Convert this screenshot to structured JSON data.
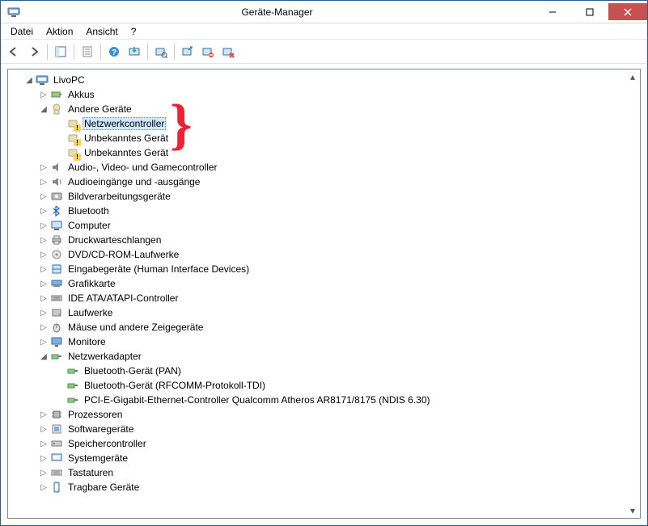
{
  "window": {
    "title": "Geräte-Manager"
  },
  "menu": {
    "file": "Datei",
    "action": "Aktion",
    "view": "Ansicht",
    "help": "?"
  },
  "root": "LivoPC",
  "nodes": {
    "akkus": "Akkus",
    "andere": "Andere Geräte",
    "andere_children": [
      "Netzwerkcontroller",
      "Unbekanntes Gerät",
      "Unbekanntes Gerät"
    ],
    "audio": "Audio-, Video- und Gamecontroller",
    "audioio": "Audioeingänge und -ausgänge",
    "bild": "Bildverarbeitungsgeräte",
    "bt": "Bluetooth",
    "computer": "Computer",
    "druck": "Druckwarteschlangen",
    "dvd": "DVD/CD-ROM-Laufwerke",
    "hid": "Eingabegeräte (Human Interface Devices)",
    "grafik": "Grafikkarte",
    "ide": "IDE ATA/ATAPI-Controller",
    "lauf": "Laufwerke",
    "maus": "Mäuse und andere Zeigegeräte",
    "mon": "Monitore",
    "net": "Netzwerkadapter",
    "net_children": [
      "Bluetooth-Gerät (PAN)",
      "Bluetooth-Gerät (RFCOMM-Protokoll-TDI)",
      "PCI-E-Gigabit-Ethernet-Controller Qualcomm Atheros AR8171/8175 (NDIS 6.30)"
    ],
    "proz": "Prozessoren",
    "soft": "Softwaregeräte",
    "speich": "Speichercontroller",
    "sys": "Systemgeräte",
    "tast": "Tastaturen",
    "trag": "Tragbare Geräte"
  }
}
